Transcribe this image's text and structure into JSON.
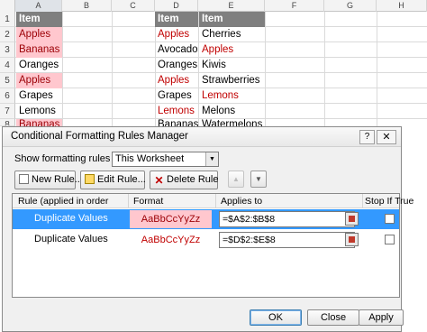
{
  "sheet": {
    "columns": [
      "A",
      "B",
      "C",
      "D",
      "E",
      "F",
      "G",
      "H"
    ],
    "rows": [
      "1",
      "2",
      "3",
      "4",
      "5",
      "6",
      "7",
      "8"
    ],
    "col_a": [
      "Item",
      "Apples",
      "Bananas",
      "Oranges",
      "Apples",
      "Grapes",
      "Lemons",
      "Bananas"
    ],
    "col_d": [
      "Item",
      "Apples",
      "Avocados",
      "Oranges",
      "Apples",
      "Grapes",
      "Lemons",
      "Bananas"
    ],
    "col_e": [
      "Item",
      "Cherries",
      "Apples",
      "Kiwis",
      "Strawberries",
      "Lemons",
      "Melons",
      "Watermelons"
    ]
  },
  "dialog": {
    "title": "Conditional Formatting Rules Manager",
    "help": "?",
    "close": "✕",
    "show_label": "Show formatting rules for:",
    "show_value": "This Worksheet",
    "buttons": {
      "new_rule": "New Rule...",
      "edit_rule": "Edit Rule...",
      "delete_rule": "Delete Rule"
    },
    "headers": {
      "rule": "Rule (applied in order shown)",
      "format": "Format",
      "applies": "Applies to",
      "stop": "Stop If True"
    },
    "rules": [
      {
        "name": "Duplicate Values",
        "preview": "AaBbCcYyZz",
        "applies": "=$A$2:$B$8"
      },
      {
        "name": "Duplicate Values",
        "preview": "AaBbCcYyZz",
        "applies": "=$D$2:$E$8"
      }
    ],
    "ok": "OK",
    "cancel": "Close",
    "apply": "Apply"
  }
}
